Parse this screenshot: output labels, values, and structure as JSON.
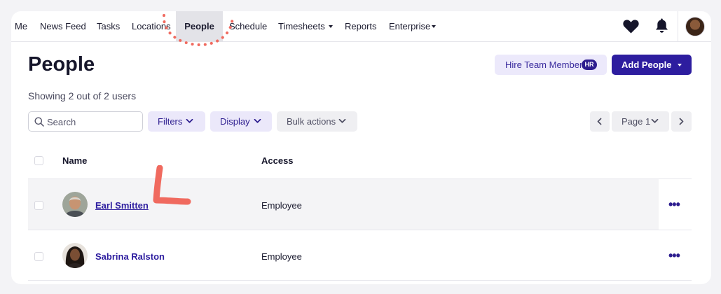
{
  "nav": {
    "items": [
      {
        "label": "Me"
      },
      {
        "label": "News Feed"
      },
      {
        "label": "Tasks"
      },
      {
        "label": "Locations"
      },
      {
        "label": "People",
        "active": true
      },
      {
        "label": "Schedule"
      },
      {
        "label": "Timesheets",
        "dropdown": true
      },
      {
        "label": "Reports"
      },
      {
        "label": "Enterprise",
        "dropdown": true
      }
    ],
    "icons": [
      "heart-icon",
      "bell-icon",
      "avatar"
    ]
  },
  "header": {
    "title": "People",
    "hire_label": "Hire Team Member",
    "hire_badge": "HR",
    "add_label": "Add People"
  },
  "summary": "Showing 2 out of 2 users",
  "toolbar": {
    "search_placeholder": "Search",
    "filters_label": "Filters",
    "display_label": "Display",
    "bulk_label": "Bulk actions",
    "page_label": "Page 1"
  },
  "table": {
    "columns": [
      "Name",
      "Access"
    ],
    "rows": [
      {
        "name": "Earl Smitten",
        "access": "Employee",
        "more": "•••"
      },
      {
        "name": "Sabrina Ralston",
        "access": "Employee",
        "more": "•••"
      }
    ]
  },
  "colors": {
    "brand": "#2d1d9f",
    "annotation": "#f06a5f",
    "active_tab_bg": "#e3e3e8"
  }
}
